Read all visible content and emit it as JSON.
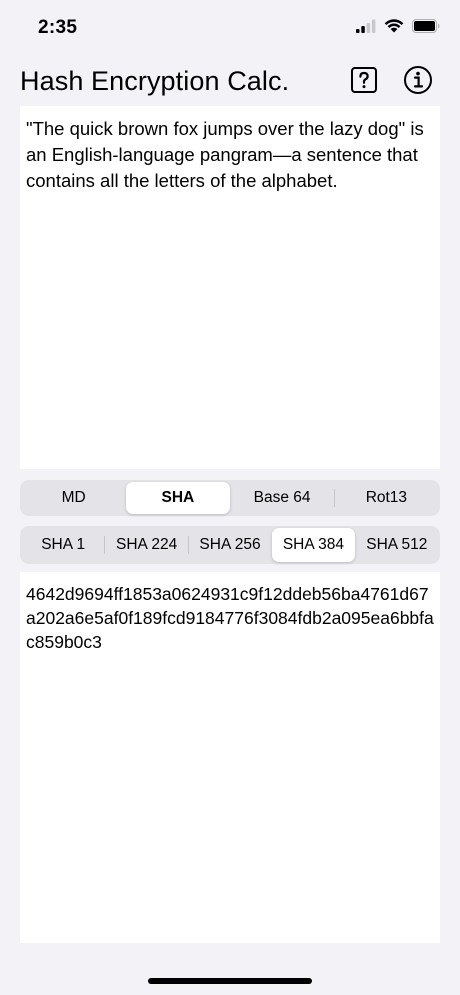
{
  "status": {
    "time": "2:35",
    "icons": [
      "signal-icon",
      "wifi-icon",
      "battery-icon"
    ]
  },
  "nav": {
    "title": "Hash Encryption Calc.",
    "help_icon": "question-mark-icon",
    "info_icon": "info-icon"
  },
  "input": {
    "text": "\"The quick brown fox jumps over the lazy dog\" is an English-language pangram—a sentence that contains all the letters of the alphabet."
  },
  "categories": {
    "selected": "SHA",
    "items": [
      {
        "label": "MD"
      },
      {
        "label": "SHA"
      },
      {
        "label": "Base 64"
      },
      {
        "label": "Rot13"
      }
    ]
  },
  "algorithms": {
    "selected": "SHA 384",
    "items": [
      {
        "label": "SHA 1"
      },
      {
        "label": "SHA 224"
      },
      {
        "label": "SHA 256"
      },
      {
        "label": "SHA 384"
      },
      {
        "label": "SHA 512"
      }
    ]
  },
  "output": {
    "text": "4642d9694ff1853a0624931c9f12ddeb56ba4761d67a202a6e5af0f189fcd9184776f3084fdb2a095ea6bbfac859b0c3"
  },
  "colors": {
    "background": "#f2f2f7",
    "surface": "#ffffff",
    "segment_track": "#e3e3e8"
  }
}
